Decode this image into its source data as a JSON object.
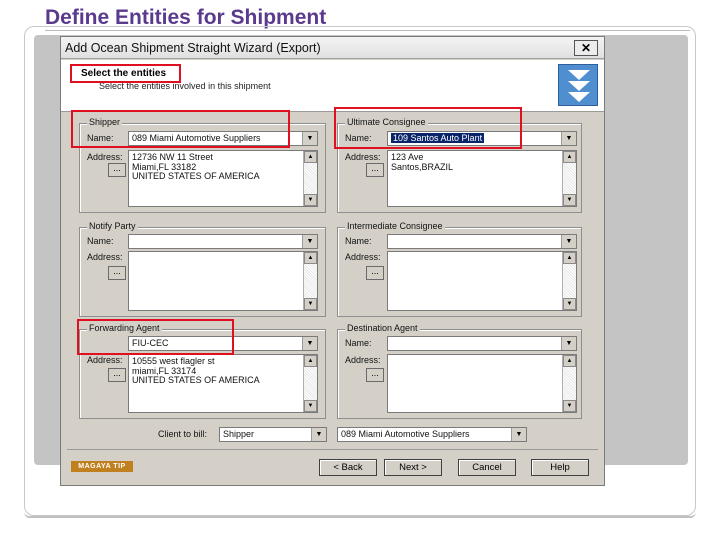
{
  "slide": {
    "title": "Define Entities for Shipment"
  },
  "window": {
    "title": "Add Ocean Shipment Straight Wizard (Export)",
    "close_glyph": "✕"
  },
  "header": {
    "step_title": "Select the entities",
    "step_subtitle": "Select the entities involved in this shipment"
  },
  "labels": {
    "name": "Name:",
    "address": "Address:",
    "dots": "..."
  },
  "shipper": {
    "group_label": "Shipper",
    "name": "089 Miami Automotive Suppliers",
    "address_lines": [
      "12736  NW 11  Street",
      "Miami,FL 33182",
      "UNITED STATES OF AMERICA"
    ]
  },
  "ultimate_consignee": {
    "group_label": "Ultimate Consignee",
    "name": "109 Santos Auto Plant",
    "address_lines": [
      "123 Ave",
      "Santos,BRAZIL"
    ]
  },
  "notify_party": {
    "group_label": "Notify Party",
    "name": "",
    "address_lines": []
  },
  "intermediate_consignee": {
    "group_label": "Intermediate Consignee",
    "name": "",
    "address_lines": []
  },
  "forwarding_agent": {
    "group_label": "Forwarding Agent",
    "name": "FIU-CEC",
    "address_lines": [
      "10555 west flagler st",
      "miami,FL 33174",
      "UNITED STATES OF AMERICA"
    ]
  },
  "destination_agent": {
    "group_label": "Destination Agent",
    "name": "",
    "address_lines": []
  },
  "client_to_bill": {
    "label": "Client to bill:",
    "type_value": "Shipper",
    "entity_value": "089 Miami Automotive Suppliers"
  },
  "footer": {
    "logo": "MAGAYA TIP",
    "back": "< Back",
    "next": "Next >",
    "cancel": "Cancel",
    "help": "Help"
  },
  "colors": {
    "highlight_red": "#e01020",
    "title_purple": "#5b3a8e",
    "selection_blue": "#0a246a",
    "dialog_gray": "#d4d0c8"
  }
}
